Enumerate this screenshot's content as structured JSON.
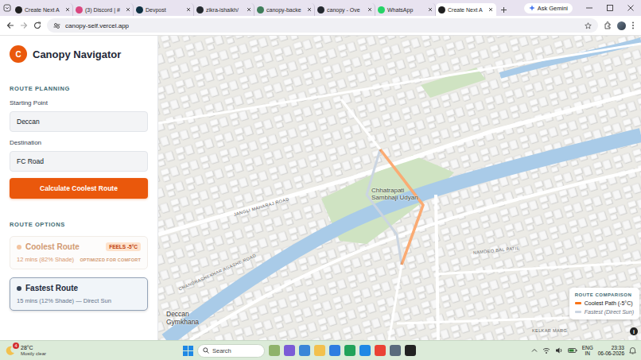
{
  "browser": {
    "tabs": [
      {
        "label": "Create Next A",
        "kind": "next",
        "selected": false
      },
      {
        "label": "(3) Discord | #",
        "kind": "discord",
        "selected": false
      },
      {
        "label": "Devpost",
        "kind": "devpost",
        "selected": false
      },
      {
        "label": "zikra-ishaikh/",
        "kind": "github",
        "selected": false
      },
      {
        "label": "canopy-backe",
        "kind": "render",
        "selected": false
      },
      {
        "label": "canopy - Ove",
        "kind": "github",
        "selected": false
      },
      {
        "label": "WhatsApp",
        "kind": "whatsapp",
        "selected": false
      },
      {
        "label": "Create Next A",
        "kind": "next",
        "selected": true
      }
    ],
    "ask_gemini": "Ask Gemini",
    "address": "canopy-self.vercel.app"
  },
  "app": {
    "logo": "C",
    "title": "Canopy Navigator",
    "route_planning": {
      "heading": "ROUTE PLANNING",
      "fields": [
        {
          "label": "Starting Point",
          "value": "Deccan"
        },
        {
          "label": "Destination",
          "value": "FC Road"
        }
      ],
      "button": "Calculate Coolest Route"
    },
    "route_options": {
      "heading": "ROUTE OPTIONS",
      "routes": [
        {
          "name": "Coolest Route",
          "details": "12 mins (82% Shade)",
          "badge": "FEELS -5°C",
          "tag": "OPTIMIZED FOR COMFORT",
          "selected": false,
          "color": "#f3c4a0"
        },
        {
          "name": "Fastest Route",
          "details": "15 mins (12% Shade) — Direct Sun",
          "badge": "",
          "tag": "",
          "selected": true,
          "color": "#334155"
        }
      ]
    }
  },
  "map": {
    "labels": [
      {
        "text": "Chhatrapati Sambhaji Udyan",
        "kind": "park"
      },
      {
        "text": "Deccan Gymkhana",
        "kind": "area"
      },
      {
        "text": "JANGLI MAHARAJ ROAD",
        "kind": "road"
      },
      {
        "text": "CHANDRASHEKHAR AGASHE ROAD",
        "kind": "road"
      },
      {
        "text": "NAMDEO BAL PATIL",
        "kind": "road"
      },
      {
        "text": "KELKAR MARG",
        "kind": "road"
      }
    ],
    "legend": {
      "title": "ROUTE COMPARISON",
      "items": [
        {
          "label": "Coolest Path (-5°C)",
          "color": "#f97316",
          "muted": false
        },
        {
          "label": "Fastest (Direct Sun)",
          "color": "#cbd5e1",
          "muted": true
        }
      ]
    },
    "info": "i"
  },
  "taskbar": {
    "weather": {
      "badge": "4",
      "temp": "28°C",
      "condition": "Mostly clear"
    },
    "search": "Search",
    "tray": {
      "lang": "ENG",
      "region": "IN",
      "time": "23:33",
      "date": "06-06-2026"
    }
  }
}
